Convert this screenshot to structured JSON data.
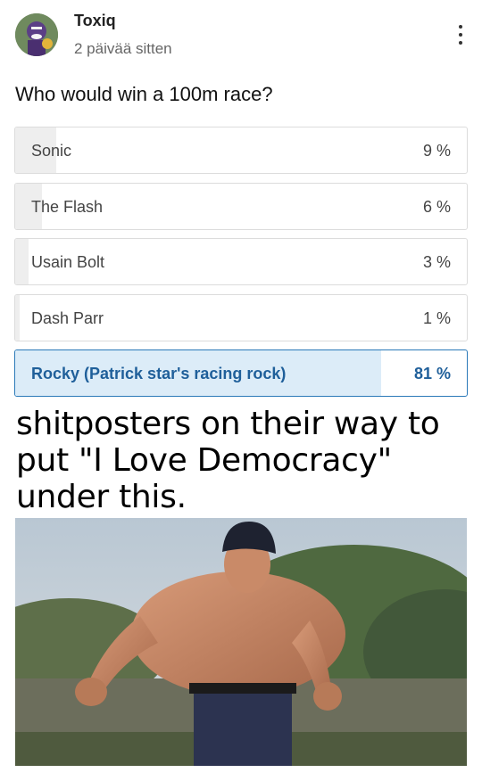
{
  "post": {
    "username": "Toxiq",
    "timestamp": "2 päivää sitten",
    "menu_icon": "more-vert-icon",
    "avatar_icon": "avatar"
  },
  "poll": {
    "question": "Who would win a 100m race?",
    "options": [
      {
        "label": "Sonic",
        "percent_text": "9 %",
        "percent": 9,
        "selected": false
      },
      {
        "label": "The Flash",
        "percent_text": "6 %",
        "percent": 6,
        "selected": false
      },
      {
        "label": "Usain Bolt",
        "percent_text": "3 %",
        "percent": 3,
        "selected": false
      },
      {
        "label": "Dash Parr",
        "percent_text": "1 %",
        "percent": 1,
        "selected": false
      },
      {
        "label": "Rocky (Patrick star's racing rock)",
        "percent_text": "81 %",
        "percent": 81,
        "selected": true
      }
    ]
  },
  "meme": {
    "caption": "shitposters on their way to put \"I Love Democracy\" under this."
  },
  "colors": {
    "accent": "#2a79b8",
    "selected_fill": "#dcecf8",
    "bar_fill": "#eeeeee"
  }
}
